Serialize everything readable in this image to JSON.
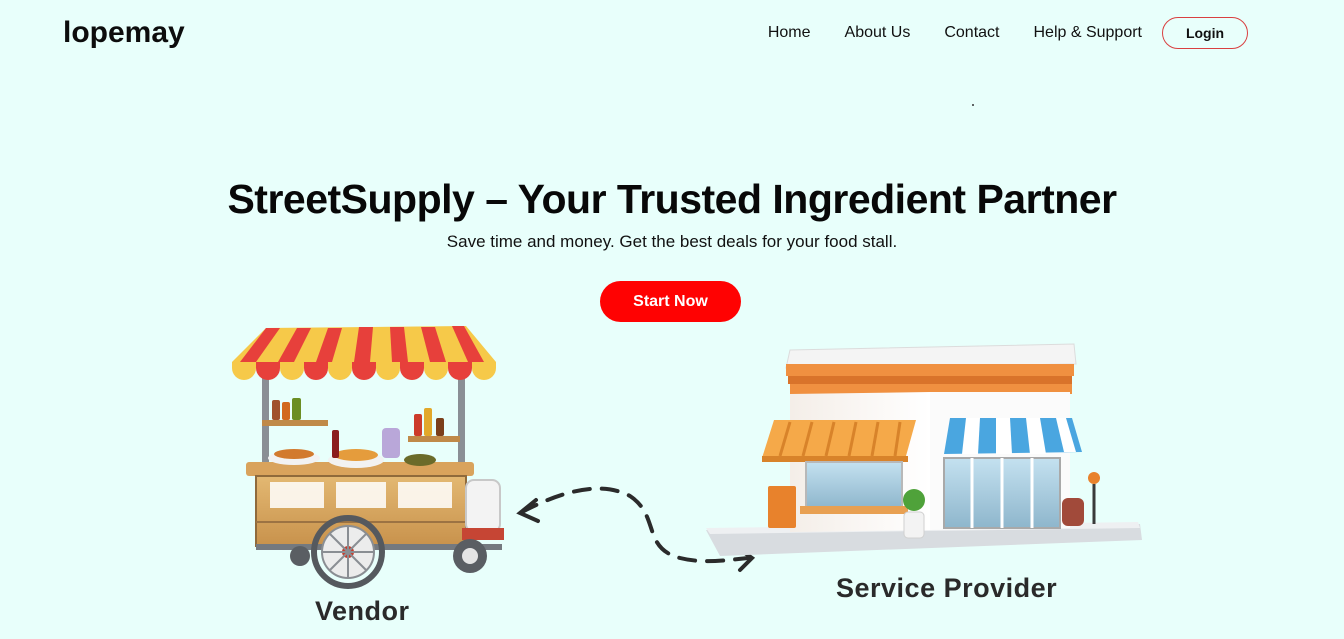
{
  "brand": {
    "name": "lopemay"
  },
  "nav": {
    "items": [
      "Home",
      "About Us",
      "Contact",
      "Help & Support"
    ],
    "login_label": "Login"
  },
  "hero": {
    "title": "StreetSupply – Your Trusted Ingredient Partner",
    "subtitle": "Save time and money. Get the best deals for your food stall.",
    "cta_label": "Start Now"
  },
  "illustration": {
    "vendor_label": "Vendor",
    "provider_label": "Service Provider",
    "vendor_icon": "food-cart-icon",
    "provider_icon": "store-building-icon",
    "connector_icon": "dashed-two-way-arrow-icon"
  },
  "colors": {
    "background": "#e8fffb",
    "accent_red": "#ff0202",
    "login_border": "#d94040"
  }
}
